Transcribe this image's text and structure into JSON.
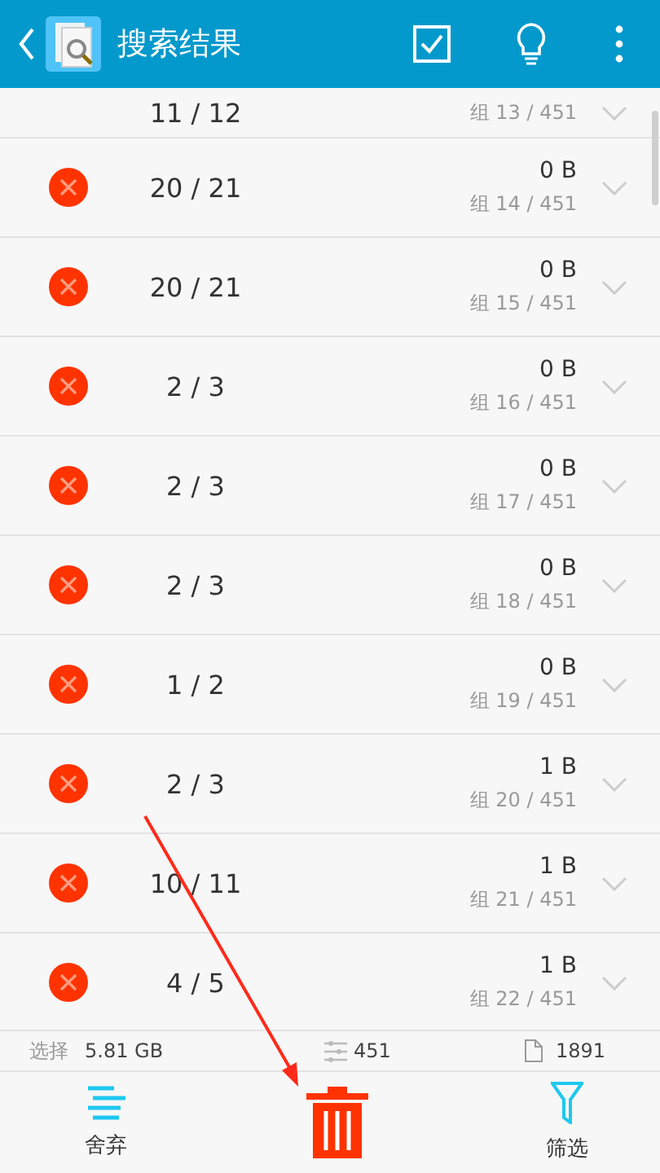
{
  "header": {
    "title": "搜索结果"
  },
  "rows": [
    {
      "kind": "cut",
      "count": "11 / 12",
      "group": "组 13 / 451"
    },
    {
      "kind": "item",
      "count": "20 / 21",
      "size": "0 B",
      "group": "组 14 / 451"
    },
    {
      "kind": "item",
      "count": "20 / 21",
      "size": "0 B",
      "group": "组 15 / 451"
    },
    {
      "kind": "item",
      "count": "2 / 3",
      "size": "0 B",
      "group": "组 16 / 451"
    },
    {
      "kind": "item",
      "count": "2 / 3",
      "size": "0 B",
      "group": "组 17 / 451"
    },
    {
      "kind": "item",
      "count": "2 / 3",
      "size": "0 B",
      "group": "组 18 / 451"
    },
    {
      "kind": "item",
      "count": "1 / 2",
      "size": "0 B",
      "group": "组 19 / 451"
    },
    {
      "kind": "item",
      "count": "2 / 3",
      "size": "1 B",
      "group": "组 20 / 451"
    },
    {
      "kind": "item",
      "count": "10 / 11",
      "size": "1 B",
      "group": "组 21 / 451"
    },
    {
      "kind": "item",
      "count": "4 / 5",
      "size": "1 B",
      "group": "组 22 / 451"
    }
  ],
  "status": {
    "label": "选择",
    "selected_size": "5.81 GB",
    "groups": "451",
    "files": "1891"
  },
  "bottom_bar": [
    {
      "kind": "discard",
      "label": "舍弃"
    },
    {
      "kind": "delete"
    },
    {
      "kind": "filter",
      "label": "筛选"
    }
  ]
}
